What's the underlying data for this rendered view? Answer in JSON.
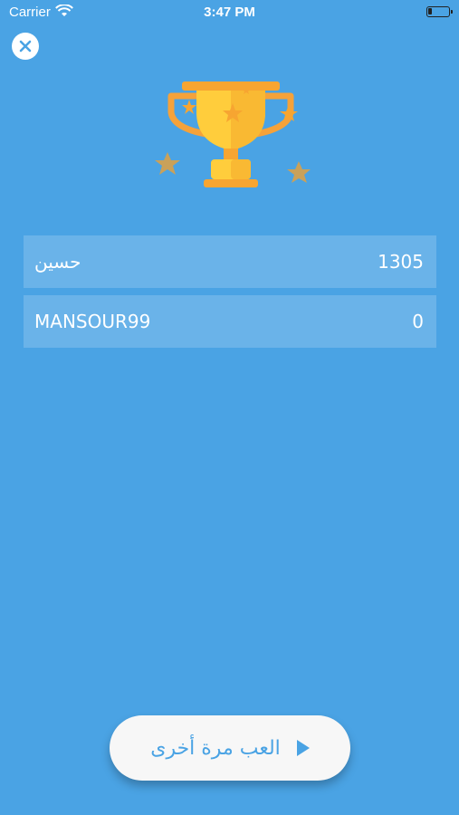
{
  "status_bar": {
    "carrier": "Carrier",
    "time": "3:47 PM"
  },
  "scores": [
    {
      "name": "حسين",
      "score": "1305"
    },
    {
      "name": "MANSOUR99",
      "score": "0"
    }
  ],
  "play_again": {
    "label": "العب مرة أخرى",
    "icon": "play-icon"
  },
  "colors": {
    "background": "#4aa3e4",
    "trophy_gold": "#ffc93c",
    "trophy_orange": "#f7a531"
  }
}
